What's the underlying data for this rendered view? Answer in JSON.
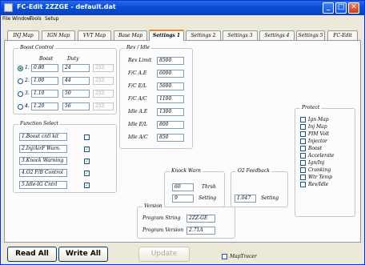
{
  "window": {
    "title": "FC-Edit 2ZZGE - default.dat"
  },
  "menu": [
    "File",
    "Window",
    "Tools",
    "Setup"
  ],
  "tabs": [
    "INJ Map",
    "IGN Map",
    "VVT Map",
    "Base Map",
    "Settings 1",
    "Settings 2",
    "Settings 3",
    "Settings 4",
    "Settings 5",
    "FC-Edit"
  ],
  "active_tab": "Settings 1",
  "boost": {
    "title": "Boost Control",
    "col_boost": "Boost",
    "col_duty": "Duty",
    "rows": [
      {
        "label": "1.",
        "boost": "0.80",
        "duty": "24",
        "extra": "255",
        "selected": true
      },
      {
        "label": "2.",
        "boost": "1.00",
        "duty": "44",
        "extra": "255",
        "selected": false
      },
      {
        "label": "3.",
        "boost": "1.10",
        "duty": "50",
        "extra": "255",
        "selected": false
      },
      {
        "label": "4.",
        "boost": "1.20",
        "duty": "56",
        "extra": "255",
        "selected": false
      }
    ]
  },
  "func": {
    "title": "Function Select",
    "items": [
      {
        "label": "1.Boost cntl kit",
        "checked": false
      },
      {
        "label": "2.Inj/AirF Warn.",
        "checked": true
      },
      {
        "label": "3.Knock Warning",
        "checked": true
      },
      {
        "label": "4.O2 F/B Control",
        "checked": true
      },
      {
        "label": "5.Idle-IG Cntrl",
        "checked": true
      }
    ]
  },
  "rev": {
    "title": "Rev / Idle",
    "rows": [
      {
        "label": "Rev Limit",
        "value": "8500"
      },
      {
        "label": "F/C A.E",
        "value": "6000"
      },
      {
        "label": "F/C E/L",
        "value": "5600"
      },
      {
        "label": "F/C A/C",
        "value": "1100"
      },
      {
        "label": "Idle A.E",
        "value": "1300"
      },
      {
        "label": "Idle E/L",
        "value": "800"
      },
      {
        "label": "Idle A/C",
        "value": "850"
      }
    ]
  },
  "knock": {
    "title": "Knock Warn",
    "thrsh_value": "60",
    "thrsh_label": "Thrsh",
    "setting_value": "9",
    "setting_label": "Setting"
  },
  "o2": {
    "title": "O2 Feedback",
    "value": "1.047",
    "label": "Setting"
  },
  "protect": {
    "title": "Protect",
    "items": [
      "Ign Map",
      "Inj Map",
      "PIM Volt",
      "Injector",
      "Boost",
      "Accelerate",
      "Ign/Inj",
      "Cranking",
      "Wtr Temp",
      "Rev/Idle"
    ]
  },
  "version": {
    "title": "Version",
    "string_label": "Program String",
    "string_value": "2ZZ-GE",
    "version_label": "Program Version",
    "version_value": "2.71A"
  },
  "bottom": {
    "read_all": "Read All",
    "write_all": "Write All",
    "update": "Update",
    "maptracer": "MapTracer"
  },
  "colors": {
    "title_bar": "#0a4fd8",
    "accent_tab": "#e68b2c",
    "check": "#21a121"
  }
}
